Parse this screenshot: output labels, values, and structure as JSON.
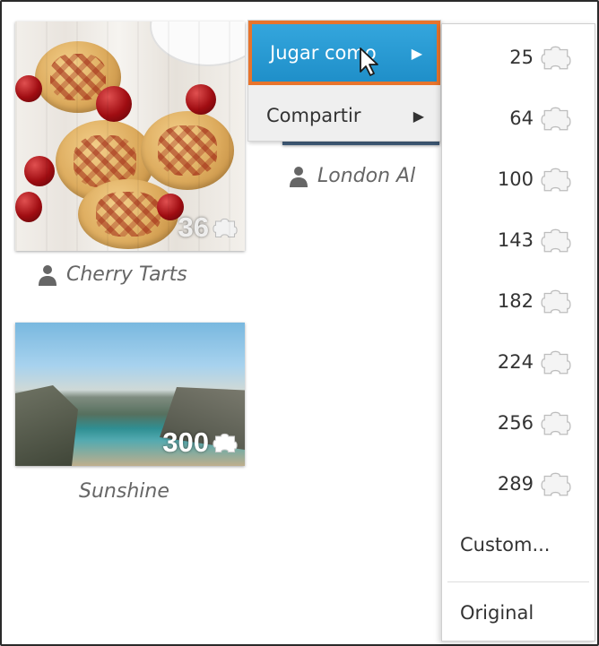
{
  "puzzles": [
    {
      "title": "Cherry Tarts",
      "pieces": "36"
    },
    {
      "title": "London Al",
      "pieces": ""
    },
    {
      "title": "Sunshine",
      "pieces": "300"
    }
  ],
  "context_menu": {
    "play_as_label": "Jugar como",
    "play_as_arrow": "▶",
    "share_label": "Compartir",
    "share_arrow": "▶"
  },
  "piece_menu": {
    "options": [
      "25",
      "64",
      "100",
      "143",
      "182",
      "224",
      "256",
      "289"
    ],
    "custom_label": "Custom...",
    "original_label": "Original"
  },
  "colors": {
    "highlight_blue": "#1f8fc9",
    "highlight_border": "#e8742c"
  },
  "icons": [
    "person-icon",
    "puzzle-piece-icon",
    "cursor-icon",
    "triangle-right-icon"
  ]
}
